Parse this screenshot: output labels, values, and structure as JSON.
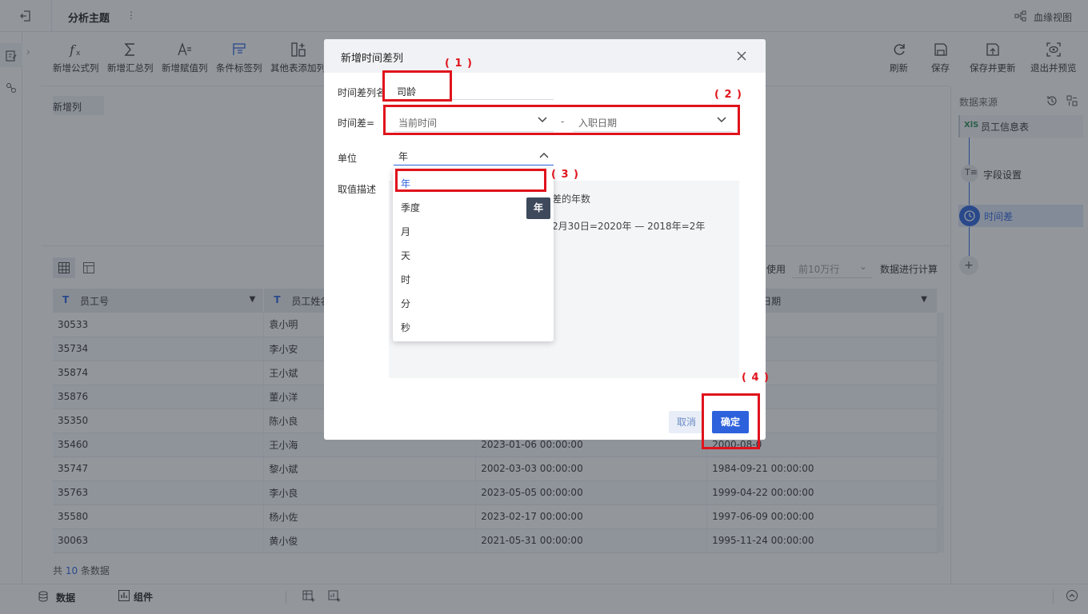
{
  "topbar": {
    "title": "分析主题",
    "lineage": "血缘视图"
  },
  "toolbar": {
    "left": [
      "新增公式列",
      "新增汇总列",
      "新增赋值列",
      "条件标签列",
      "其他表添加列"
    ],
    "right": [
      "刷新",
      "保存",
      "保存并更新",
      "退出并预览"
    ]
  },
  "tab_new_column": "新增列",
  "data_table": {
    "headers": [
      "员工号",
      "员工姓名",
      "",
      "入职日期"
    ],
    "rows": [
      [
        "30533",
        "袁小明",
        "",
        "00:00:00"
      ],
      [
        "35734",
        "李小安",
        "",
        "00:00:00"
      ],
      [
        "35874",
        "王小斌",
        "",
        "00:00:00"
      ],
      [
        "35876",
        "董小洋",
        "",
        "00:00:00"
      ],
      [
        "35350",
        "陈小良",
        "",
        "00:00:00"
      ],
      [
        "35460",
        "王小海",
        "2023-01-06 00:00:00",
        "2000-08-0"
      ],
      [
        "35747",
        "黎小斌",
        "2002-03-03 00:00:00",
        "1984-09-21 00:00:00"
      ],
      [
        "35763",
        "李小良",
        "2023-05-05 00:00:00",
        "1999-04-22 00:00:00"
      ],
      [
        "35580",
        "杨小佐",
        "2023-02-17 00:00:00",
        "1997-06-09 00:00:00"
      ],
      [
        "30063",
        "黄小俊",
        "2021-05-31 00:00:00",
        "1995-11-24 00:00:00"
      ]
    ],
    "hint_use": "使用",
    "hint_limit": "前10万行",
    "hint_calc": "数据进行计算",
    "count_prefix": "共 ",
    "count_num": "10",
    "count_suffix": " 条数据"
  },
  "right_panel": {
    "title": "数据来源",
    "steps": [
      "员工信息表",
      "字段设置",
      "时间差"
    ]
  },
  "bottom": {
    "data_tab": "数据",
    "component_tab": "组件"
  },
  "dialog": {
    "title": "新增时间差列",
    "name_label": "时间差列名",
    "name_value": "司龄",
    "diff_label": "时间差=",
    "diff_from": "当前时间",
    "diff_sep": "-",
    "diff_to": "入职日期",
    "unit_label": "单位",
    "unit_value": "年",
    "desc_label": "取值描述",
    "desc_line1": "差的年数",
    "desc_line2": "2月30日=2020年 — 2018年=2年",
    "unit_options": [
      "年",
      "季度",
      "月",
      "天",
      "时",
      "分",
      "秒"
    ],
    "tooltip": "年",
    "cancel": "取消",
    "confirm": "确定"
  },
  "annotations": [
    "( 1 )",
    "( 2 )",
    "( 3 )",
    "( 4 )"
  ],
  "colors": {
    "accent": "#2d62dc",
    "annotation": "#e0131c",
    "tooltip": "#3e4a5c"
  }
}
